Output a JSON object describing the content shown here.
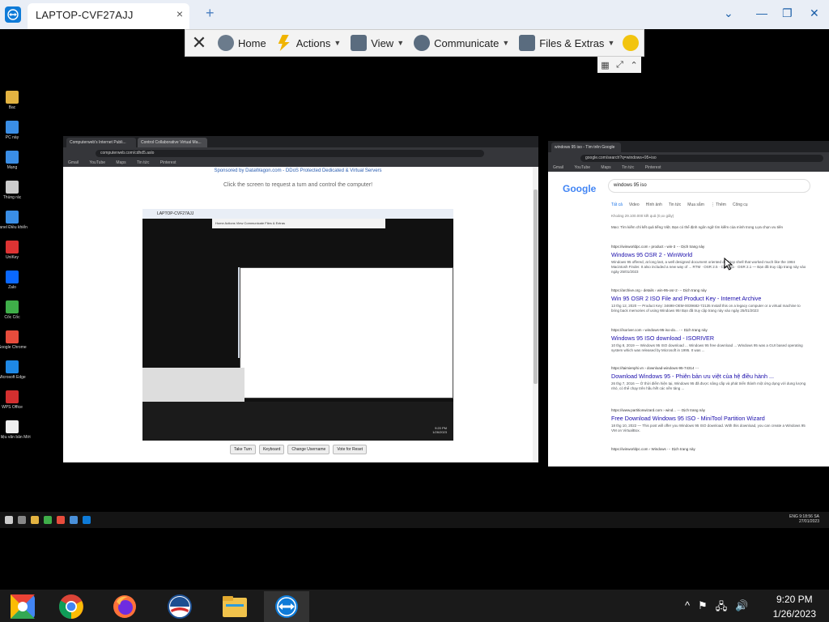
{
  "teamviewer": {
    "tab_title": "LAPTOP-CVF27AJJ",
    "tab_close": "×",
    "new_tab": "+",
    "window_controls": {
      "minimize": "—",
      "restore": "❐",
      "close": "✕",
      "dropdown": "⌄"
    },
    "toolbar": {
      "close": "✕",
      "items": [
        "Home",
        "Actions",
        "View",
        "Communicate",
        "Files & Extras"
      ],
      "sub_controls": [
        "▦",
        "⤢",
        "⌃"
      ]
    }
  },
  "remote_desktop": {
    "icons": [
      {
        "label": "Bac",
        "color": "#e3b341"
      },
      {
        "label": "PC này",
        "color": "#3a8ee6"
      },
      {
        "label": "Mạng",
        "color": "#3a8ee6"
      },
      {
        "label": "Thùng rác",
        "color": "#ccc"
      },
      {
        "label": "Panel Điều khiển",
        "color": "#3a8ee6"
      },
      {
        "label": "UniKey",
        "color": "#d33"
      },
      {
        "label": "Zalo",
        "color": "#0a68ff"
      },
      {
        "label": "Cốc Cốc",
        "color": "#3fae49"
      },
      {
        "label": "Google Chrome",
        "color": "#e74c3c"
      },
      {
        "label": "Microsoft Edge",
        "color": "#1e88e5"
      },
      {
        "label": "WPS Office",
        "color": "#d32f2f"
      },
      {
        "label": "Tài liệu văn bản Mới",
        "color": "#eee"
      }
    ],
    "left_browser": {
      "tabs": [
        "Computerweb's Internet Publi...",
        "Control Collaborative Virtual Ma..."
      ],
      "url": "computerweb.com/cdhd5.aslo",
      "bookmarks": [
        "Gmail",
        "YouTube",
        "Maps",
        "Tin tức",
        "Pinterest"
      ],
      "sponsor": "Sponsored by DataWagon.com - DDoS Protected Dedicated & Virtual Servers",
      "instruction": "Click the screen to request a turn and control the computer!",
      "nested_title": "LAPTOP-CVF27AJJ",
      "nested_toolbar": "Home   Actions   View   Communicate   Files & Extras",
      "nested_time": "9:20 PM\n1/26/2023",
      "buttons": [
        "Take Turn",
        "Keyboard",
        "Change Username",
        "Vote for Reset"
      ]
    },
    "right_browser": {
      "tabs": [
        "windows 95 iso - Tìm trên Google"
      ],
      "url": "google.com/search?q=windows+95+iso",
      "bookmarks": [
        "Gmail",
        "YouTube",
        "Maps",
        "Tin tức",
        "Pinterest"
      ],
      "search_query": "windows 95 iso",
      "logo": "Google",
      "tabs_row": [
        "Tất cả",
        "Video",
        "Hình ảnh",
        "Tin tức",
        "Mua sắm",
        "⋮ Thêm",
        "Công cụ"
      ],
      "count": "Khoảng 29.100.000 kết quả (0,xx giây)",
      "note": "Mẹo: Tìm kiếm chỉ kết quả tiếng Việt. Bạn có thể định ngôn ngữ tìm kiếm của mình trong Lựa chọn ưu tiên",
      "results": [
        {
          "cite": "https://winworldpc.com › product › win-3 ⋯ Dịch trang này",
          "title": "Windows 95 OSR 2 - WinWorld",
          "snippet": "Windows 95 offered, at long last, a well designed document oriented desktop shell that worked much like the 1984 Macintosh Finder. It also included a new way of ... RTM · OSR 2.5 · Chicago · OSR 2.1 — Bạn đã truy cập trang này vào ngày 25/01/2023"
        },
        {
          "cite": "https://archive.org › details › win-95-osr-2 ⋯ Dịch trang này",
          "title": "Win 95 OSR 2 ISO File and Product Key - Internet Archive",
          "snippet": "13 thg 12, 2020 — Product Key: 34698-OEM-0039682-72135 Install this on a legacy computer or a virtual machine to bring back memories of using Windows 95! Bạn đã truy cập trang này vào ngày 25/01/2023"
        },
        {
          "cite": "https://isoriver.com › windows-95-iso-do... ⋯ Dịch trang này",
          "title": "Windows 95 ISO download - ISORIVER",
          "snippet": "10 thg 8, 2019 — Windows 95 ISO download ... Windows 95 free download ... Windows 95 was a GUI based operating system which was released by Microsoft in 1995. It was ..."
        },
        {
          "cite": "https://taimienphi.vn › download-windows-95-74314 ⋯",
          "title": "Download Windows 95 - Phiên bản ưu việt của hệ điều hành ...",
          "snippet": "26 thg 7, 2016 — Ở thời điểm hiện tại, Windows 95 đã được nâng cấp và phát triển thành một ứng dụng với dung lượng nhỏ, có thể chạy trên hầu hết các nền tảng ..."
        },
        {
          "cite": "https://www.partitionwizard.com › wind... ⋯ Dịch trang này",
          "title": "Free Download Windows 95 ISO - MiniTool Partition Wizard",
          "snippet": "18 thg 10, 2022 — This post will offer you Windows 95 ISO download. With this download, you can create a Windows 95 VM on VirtualBox."
        },
        {
          "cite": "https://winworldpc.com › Windows ⋯ Dịch trang này",
          "title": "",
          "snippet": ""
        }
      ]
    },
    "taskbar": {
      "time": "9:18:56 SA",
      "date": "27/01/2023",
      "lang": "ENG"
    }
  },
  "local_taskbar": {
    "apps": [
      {
        "name": "Chrome Remote Desktop",
        "active": false
      },
      {
        "name": "Google Chrome",
        "active": false
      },
      {
        "name": "Firefox",
        "active": false
      },
      {
        "name": "Obama",
        "active": false
      },
      {
        "name": "File Explorer",
        "active": false
      },
      {
        "name": "TeamViewer",
        "active": true
      }
    ],
    "tray_icons": [
      "^",
      "⚑",
      "🖧",
      "🔊"
    ],
    "time": "9:20 PM",
    "date": "1/26/2023"
  }
}
